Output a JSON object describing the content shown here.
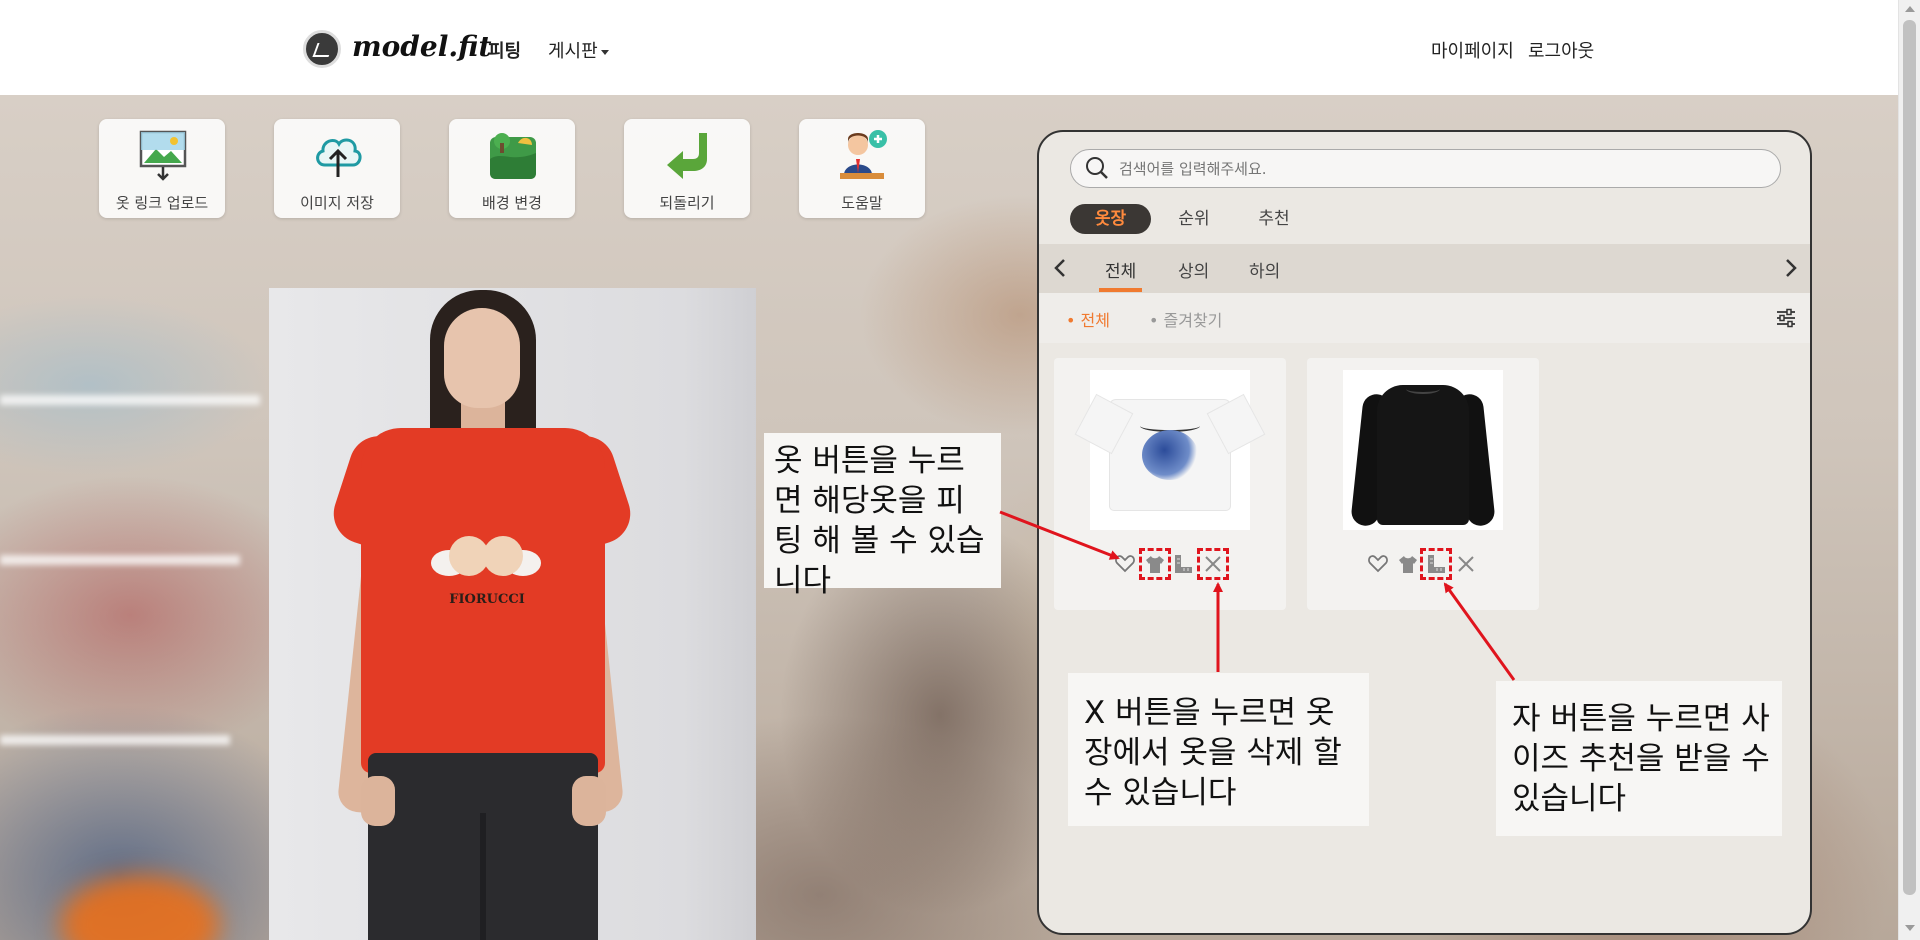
{
  "navbar": {
    "brand": "model.fit",
    "links": {
      "fitting": "피팅",
      "board": "게시판",
      "mypage": "마이페이지",
      "logout": "로그아웃"
    }
  },
  "tools": [
    {
      "label": "옷 링크 업로드",
      "icon": "image-upload-icon"
    },
    {
      "label": "이미지 저장",
      "icon": "cloud-upload-icon"
    },
    {
      "label": "배경 변경",
      "icon": "landscape-icon"
    },
    {
      "label": "되돌리기",
      "icon": "undo-arrow-icon"
    },
    {
      "label": "도움말",
      "icon": "help-agent-icon"
    }
  ],
  "model_photo": {
    "shirt_print": "FIORUCCI"
  },
  "closet": {
    "search_placeholder": "검색어를 입력해주세요.",
    "tabs": [
      "옷장",
      "순위",
      "추천"
    ],
    "active_tab": "옷장",
    "categories": [
      "전체",
      "상의",
      "하의"
    ],
    "active_category": "전체",
    "filters": [
      "• 전체",
      "• 즐겨찾기"
    ],
    "active_filter": "• 전체",
    "items": [
      {
        "name": "white-graphic-tshirt",
        "actions": [
          "heart-icon",
          "shirt-icon",
          "ruler-icon",
          "close-icon"
        ]
      },
      {
        "name": "black-sweater",
        "actions": [
          "heart-icon",
          "shirt-icon",
          "ruler-icon",
          "close-icon"
        ]
      }
    ]
  },
  "callouts": {
    "fit": "옷 버튼을 누르면 해당옷을 피팅 해 볼 수 있습니다",
    "delete": "X 버튼을 누르면 옷장에서 옷을 삭제 할 수 있습니다",
    "size": "자 버튼을 누르면 사이즈 추천을 받을 수 있습니다"
  },
  "colors": {
    "accent": "#f07a30",
    "annotation": "#e0141d",
    "tab_active_bg": "#3b3734"
  }
}
